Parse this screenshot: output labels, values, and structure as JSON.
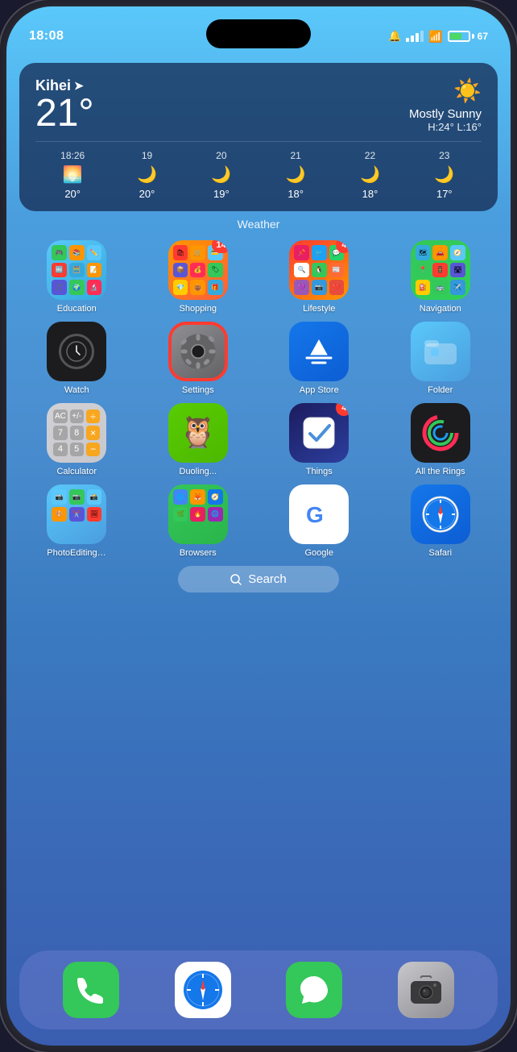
{
  "phone": {
    "status": {
      "time": "18:08",
      "battery": "67",
      "bell_muted": true
    },
    "weather": {
      "city": "Kihei",
      "temp": "21°",
      "condition": "Mostly Sunny",
      "high": "H:24°",
      "low": "L:16°",
      "forecast": [
        {
          "time": "18:26",
          "icon": "🌅",
          "temp": "20°"
        },
        {
          "time": "19",
          "icon": "🌙",
          "temp": "20°"
        },
        {
          "time": "20",
          "icon": "🌙",
          "temp": "19°"
        },
        {
          "time": "21",
          "icon": "🌙",
          "temp": "18°"
        },
        {
          "time": "22",
          "icon": "🌙",
          "temp": "18°"
        },
        {
          "time": "23",
          "icon": "🌙",
          "temp": "17°"
        }
      ],
      "widget_label": "Weather"
    },
    "apps": [
      {
        "id": "education",
        "label": "Education",
        "icon_class": "icon-education",
        "badge": null
      },
      {
        "id": "shopping",
        "label": "Shopping",
        "icon_class": "icon-shopping",
        "badge": "14"
      },
      {
        "id": "lifestyle",
        "label": "Lifestyle",
        "icon_class": "icon-lifestyle",
        "badge": "4"
      },
      {
        "id": "navigation",
        "label": "Navigation",
        "icon_class": "icon-navigation",
        "badge": null
      },
      {
        "id": "watch",
        "label": "Watch",
        "icon_class": "icon-watch",
        "badge": null
      },
      {
        "id": "settings",
        "label": "Settings",
        "icon_class": "icon-settings",
        "badge": null,
        "highlighted": true
      },
      {
        "id": "appstore",
        "label": "App Store",
        "icon_class": "icon-appstore",
        "badge": null
      },
      {
        "id": "folder",
        "label": "Folder",
        "icon_class": "icon-folder",
        "badge": null
      },
      {
        "id": "calculator",
        "label": "Calculator",
        "icon_class": "icon-calculator",
        "badge": null
      },
      {
        "id": "duolingo",
        "label": "Duoling...",
        "icon_class": "icon-duolingo",
        "badge": null
      },
      {
        "id": "things",
        "label": "Things",
        "icon_class": "icon-things",
        "badge": "4"
      },
      {
        "id": "allrings",
        "label": "All the Rings",
        "icon_class": "icon-allrings",
        "badge": null
      },
      {
        "id": "photoediting",
        "label": "PhotoEditingSh...",
        "icon_class": "icon-photoediting",
        "badge": null
      },
      {
        "id": "browsers",
        "label": "Browsers",
        "icon_class": "icon-browsers",
        "badge": null
      },
      {
        "id": "google",
        "label": "Google",
        "icon_class": "icon-google",
        "badge": null
      },
      {
        "id": "safari",
        "label": "Safari",
        "icon_class": "icon-safari",
        "badge": null
      }
    ],
    "search": {
      "label": "Search",
      "placeholder": "Search"
    },
    "dock": [
      {
        "id": "phone",
        "icon_class": "icon-phone",
        "label": "Phone"
      },
      {
        "id": "safari-dock",
        "icon_class": "icon-safari-dock",
        "label": "Safari"
      },
      {
        "id": "messages",
        "icon_class": "icon-messages",
        "label": "Messages"
      },
      {
        "id": "camera",
        "icon_class": "icon-camera",
        "label": "Camera"
      }
    ]
  }
}
